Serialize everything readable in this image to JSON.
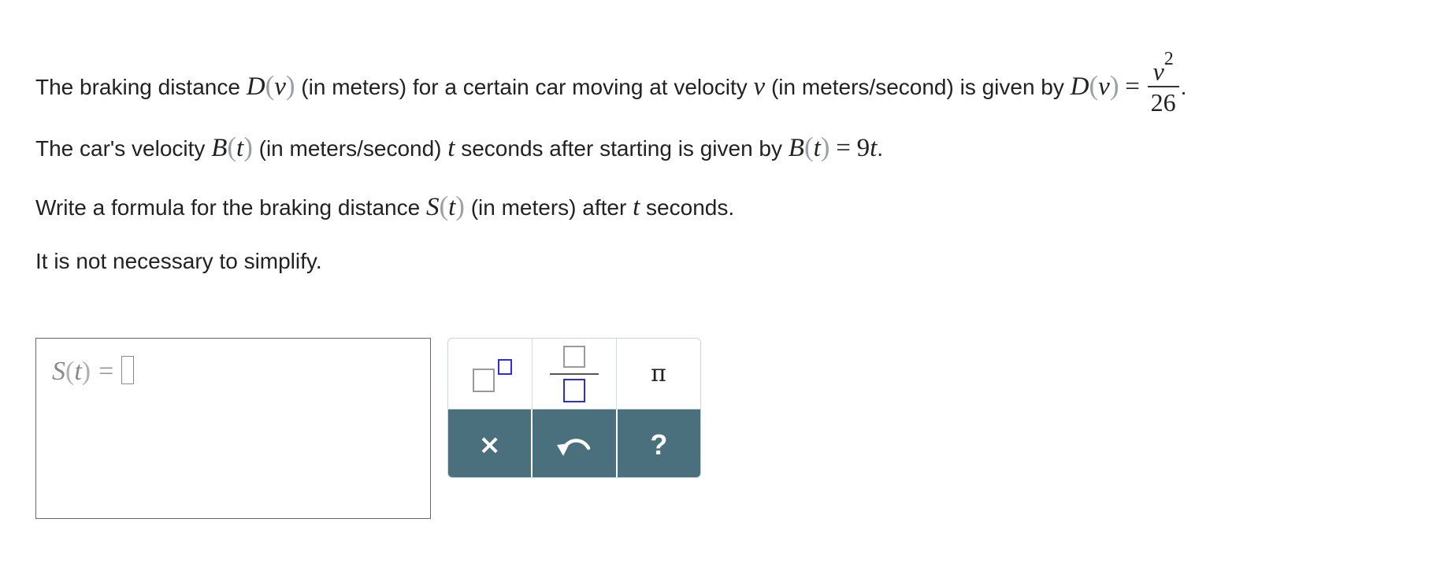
{
  "problem": {
    "line1": {
      "text_a": "The braking distance ",
      "fn_name": "D",
      "fn_arg": "v",
      "text_b": " (in meters) for a certain car moving at velocity ",
      "var": "v",
      "text_c": " (in meters/second) is given by ",
      "formula_fn": "D",
      "formula_arg": "v",
      "equals": "=",
      "numerator_var": "v",
      "numerator_exp": "2",
      "denominator": "26",
      "end": "."
    },
    "line2": {
      "text_a": "The car's velocity ",
      "fn_name": "B",
      "fn_arg": "t",
      "text_b": " (in meters/second) ",
      "var": "t",
      "text_c": " seconds after starting is given by ",
      "formula_fn": "B",
      "formula_arg": "t",
      "equals": "=",
      "rhs": "9",
      "rhs_var": "t",
      "end": "."
    },
    "line3": {
      "text_a": "Write a formula for the braking distance ",
      "fn_name": "S",
      "fn_arg": "t",
      "text_b": " (in meters) after ",
      "var": "t",
      "text_c": " seconds."
    },
    "line4": "It is not necessary to simplify."
  },
  "answer": {
    "fn_name": "S",
    "fn_arg": "t",
    "equals": "="
  },
  "palette": {
    "pi_symbol": "π",
    "clear_symbol": "×",
    "help_symbol": "?",
    "superscript_icon": "superscript-template-icon",
    "fraction_icon": "fraction-template-icon",
    "undo_icon": "undo-icon"
  },
  "colors": {
    "toolbar_dark": "#4a707d",
    "placeholder_blue": "#2d2de0",
    "text": "#222222"
  }
}
